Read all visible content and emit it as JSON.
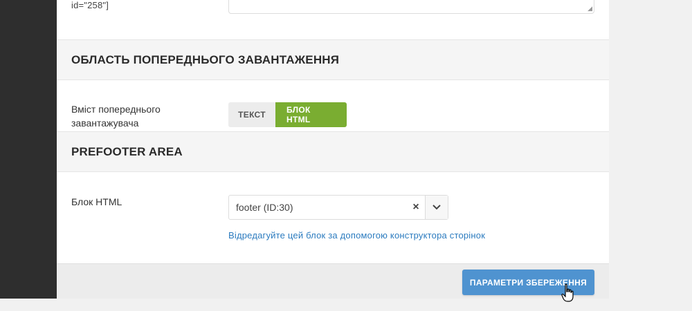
{
  "shortcode_fragment": "id=\"258\"]",
  "preloader_section": {
    "title": "ОБЛАСТЬ ПОПЕРЕДНЬОГО ЗАВАНТАЖЕННЯ",
    "content_label": "Вміст попереднього завантажувача",
    "toggle_options": [
      "ТЕКСТ",
      "БЛОК HTML"
    ],
    "selected_option": "БЛОК HTML"
  },
  "prefooter_section": {
    "title": "PREFOOTER AREA",
    "html_block_label": "Блок HTML",
    "select_value": "footer (ID:30)",
    "clear_symbol": "×",
    "edit_link": "Відредагуйте цей блок за допомогою конструктора сторінок"
  },
  "footer": {
    "save_label": "ПАРАМЕТРИ ЗБЕРЕЖЕННЯ"
  },
  "colors": {
    "accent_green": "#7aad31",
    "button_blue": "#4f93d0",
    "link_blue": "#2b7bbf"
  },
  "icons": {
    "clear": "close-icon",
    "dropdown": "chevron-down-icon",
    "cursor": "hand-pointer-icon"
  }
}
